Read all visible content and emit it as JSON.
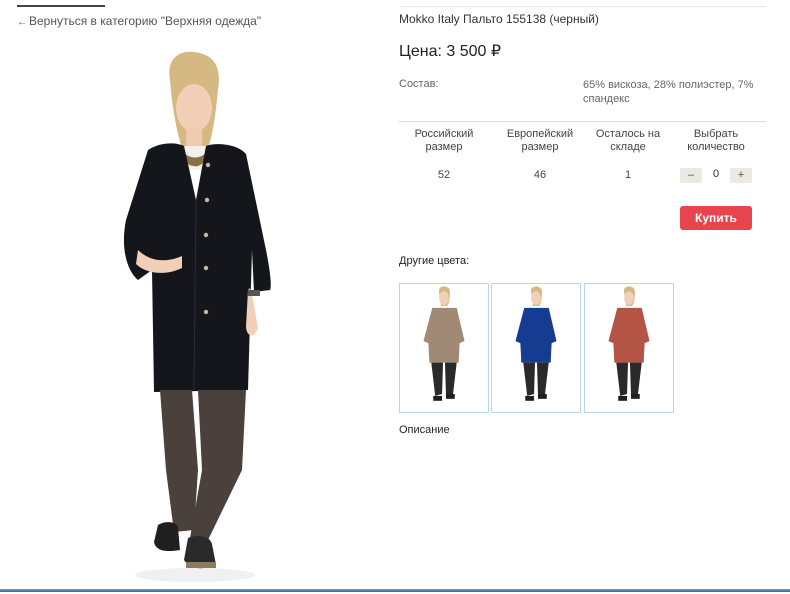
{
  "nav": {
    "back_arrow": "←",
    "back_label": "Вернуться в категорию \"Верхняя одежда\""
  },
  "product": {
    "title": "Mokko Italy Пальто 155138 (черный)",
    "price": "Цена: 3 500 ₽",
    "composition_label": "Состав:",
    "composition_value": "65% вискоза, 28% полиэстер, 7% спандекс",
    "coat_color": "#15161c"
  },
  "table": {
    "headers": [
      "Российский размер",
      "Европейский размер",
      "Осталось на складе",
      "Выбрать количество"
    ],
    "row": {
      "ru_size": "52",
      "eu_size": "46",
      "stock": "1"
    },
    "qty": {
      "minus": "–",
      "value": "0",
      "plus": "+"
    }
  },
  "buy_label": "Купить",
  "buy_color": "#e8444d",
  "other_colors_label": "Другие цвета:",
  "other_colors": [
    {
      "name": "beige",
      "coat": "#a08a76"
    },
    {
      "name": "blue",
      "coat": "#163c92"
    },
    {
      "name": "terracotta",
      "coat": "#b35444"
    }
  ],
  "description_label": "Описание"
}
